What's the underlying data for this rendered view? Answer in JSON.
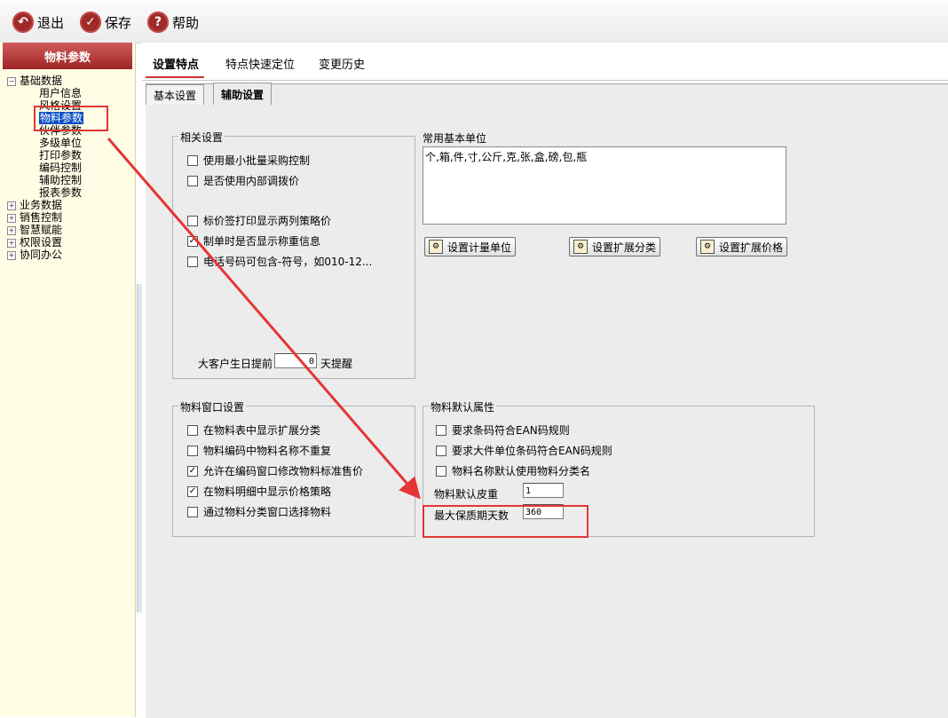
{
  "toolbar": {
    "exit_label": "退出",
    "save_label": "保存",
    "help_label": "帮助",
    "exit_icon": "back-arrow-icon",
    "save_icon": "check-icon",
    "help_icon": "question-icon"
  },
  "sidebar": {
    "title": "物料参数",
    "tree": [
      {
        "label": "基础数据",
        "expanded": true,
        "children": [
          "用户信息",
          "风格设置",
          "物料参数",
          "伙伴参数",
          "多级单位",
          "打印参数",
          "编码控制",
          "辅助控制",
          "报表参数"
        ]
      },
      {
        "label": "业务数据",
        "expanded": false
      },
      {
        "label": "销售控制",
        "expanded": false
      },
      {
        "label": "智慧赋能",
        "expanded": false
      },
      {
        "label": "权限设置",
        "expanded": false
      },
      {
        "label": "协同办公",
        "expanded": false
      }
    ],
    "selected": "物料参数"
  },
  "tabs": [
    "设置特点",
    "特点快速定位",
    "变更历史"
  ],
  "subtabs": [
    "基本设置",
    "辅助设置"
  ],
  "related": {
    "title": "相关设置",
    "items": [
      {
        "label": "使用最小批量采购控制",
        "checked": false
      },
      {
        "label": "是否使用内部调拨价",
        "checked": false
      },
      {
        "label": "标价签打印显示两列策略价",
        "checked": false
      },
      {
        "label": "制单时是否显示称重信息",
        "checked": true
      },
      {
        "label": "电话号码可包含-符号，如010-12...",
        "checked": false
      }
    ],
    "birthday_prefix": "大客户生日提前",
    "birthday_value": "0",
    "birthday_suffix": "天提醒"
  },
  "units": {
    "title": "常用基本单位",
    "value": "个,箱,件,寸,公斤,克,张,盒,磅,包,瓶",
    "buttons": [
      "设置计量单位",
      "设置扩展分类",
      "设置扩展价格"
    ]
  },
  "window_settings": {
    "title": "物料窗口设置",
    "items": [
      {
        "label": "在物料表中显示扩展分类",
        "checked": false
      },
      {
        "label": "物料编码中物料名称不重复",
        "checked": false
      },
      {
        "label": "允许在编码窗口修改物料标准售价",
        "checked": true
      },
      {
        "label": "在物料明细中显示价格策略",
        "checked": true
      },
      {
        "label": "通过物料分类窗口选择物料",
        "checked": false
      }
    ]
  },
  "default_attrs": {
    "title": "物料默认属性",
    "items": [
      {
        "label": "要求条码符合EAN码规则",
        "checked": false
      },
      {
        "label": "要求大件单位条码符合EAN码规则",
        "checked": false
      },
      {
        "label": "物料名称默认使用物料分类名",
        "checked": false
      }
    ],
    "tare_label": "物料默认皮重",
    "tare_value": "1",
    "shelf_label": "最大保质期天数",
    "shelf_value": "360"
  },
  "colors": {
    "highlight": "#e53535",
    "header": "#9f2525",
    "sidebar_bg": "#fffde6"
  }
}
